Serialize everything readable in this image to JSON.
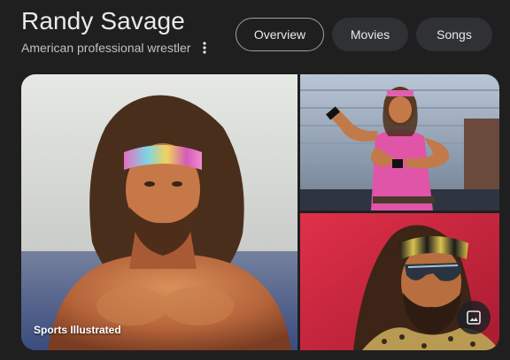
{
  "header": {
    "title": "Randy Savage",
    "subtitle": "American professional wrestler"
  },
  "tabs": [
    {
      "label": "Overview",
      "active": true
    },
    {
      "label": "Movies",
      "active": false
    },
    {
      "label": "Songs",
      "active": false
    }
  ],
  "gallery": {
    "main_caption": "Sports Illustrated"
  },
  "icons": {
    "more": "more-vert-icon",
    "images": "image-gallery-icon"
  },
  "colors": {
    "background": "#1f1f1f",
    "chip": "#303134",
    "chip_border": "#9aa0a6",
    "text": "#e8eaed",
    "subtext": "#bdc1c6"
  }
}
